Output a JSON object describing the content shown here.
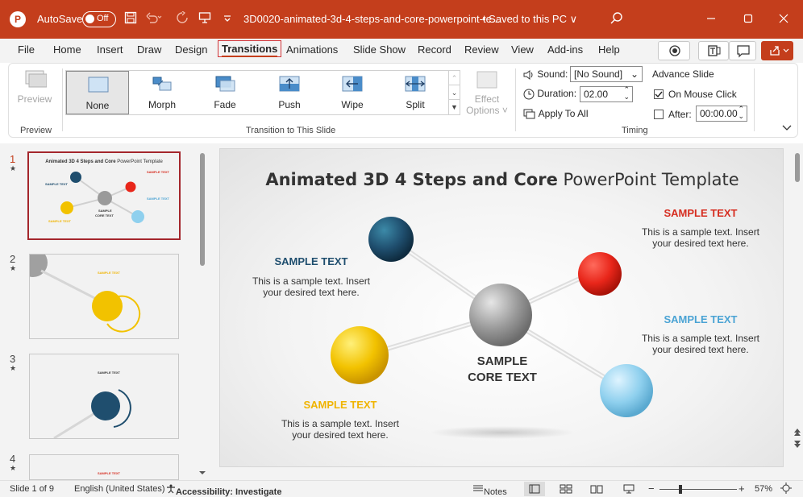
{
  "titlebar": {
    "logo": "P",
    "autosave_label": "AutoSave",
    "autosave_state": "Off",
    "doc_title": "3D0020-animated-3d-4-steps-and-core-powerpoint-te...",
    "saved_status": "• Saved to this PC ∨",
    "icons": [
      "save-icon",
      "undo-icon",
      "redo-icon",
      "present-icon",
      "customize-icon",
      "search-icon",
      "minimize-icon",
      "maximize-icon",
      "close-icon"
    ]
  },
  "menu": {
    "tabs": [
      "File",
      "Home",
      "Insert",
      "Draw",
      "Design",
      "Transitions",
      "Animations",
      "Slide Show",
      "Record",
      "Review",
      "View",
      "Add-ins",
      "Help"
    ],
    "active": "Transitions"
  },
  "ribbon": {
    "preview": {
      "label": "Preview",
      "group": "Preview"
    },
    "gallery": {
      "items": [
        "None",
        "Morph",
        "Fade",
        "Push",
        "Wipe",
        "Split"
      ],
      "selected": "None",
      "group": "Transition to This Slide"
    },
    "effect_options": {
      "line1": "Effect",
      "line2": "Options ˅"
    },
    "timing": {
      "sound_label": "Sound:",
      "sound_value": "[No Sound]",
      "duration_label": "Duration:",
      "duration_value": "02.00",
      "apply_all": "Apply To All",
      "advance_title": "Advance Slide",
      "on_mouse_click": "On Mouse Click",
      "on_mouse_click_checked": true,
      "after_label": "After:",
      "after_value": "00:00.00",
      "after_checked": false,
      "group": "Timing"
    }
  },
  "thumbnails": {
    "numbers": [
      "1",
      "2",
      "3",
      "4"
    ],
    "star": "★",
    "thumb1": {
      "title_bold": "Animated 3D 4 Steps and Core",
      "title_rest": " PowerPoint Template",
      "labels": [
        "SAMPLE TEXT",
        "SAMPLE TEXT",
        "SAMPLE TEXT",
        "SAMPLE TEXT",
        "SAMPLE",
        "CORE TEXT"
      ]
    },
    "thumb2": {
      "label": "SAMPLE TEXT"
    },
    "thumb3": {
      "label": "SAMPLE TEXT"
    },
    "thumb4": {
      "label": "SAMPLE TEXT"
    }
  },
  "slide": {
    "title_bold": "Animated 3D 4 Steps and Core",
    "title_rest": " PowerPoint Template",
    "blocks": [
      {
        "title": "SAMPLE TEXT",
        "color": "#1f4e6e",
        "line1": "This is a sample text. Insert",
        "line2": "your desired text here."
      },
      {
        "title": "SAMPLE TEXT",
        "color": "#d62d20",
        "line1": "This is a sample text. Insert",
        "line2": "your desired text here."
      },
      {
        "title": "SAMPLE TEXT",
        "color": "#4aa3d4",
        "line1": "This is a sample text. Insert",
        "line2": "your desired text here."
      },
      {
        "title": "SAMPLE TEXT",
        "color": "#f0b400",
        "line1": "This is a sample text. Insert",
        "line2": "your desired text here."
      }
    ],
    "core_line1": "SAMPLE",
    "core_line2": "CORE TEXT"
  },
  "statusbar": {
    "slide_info": "Slide 1 of 9",
    "language": "English (United States)",
    "accessibility": "Accessibility: Investigate",
    "notes": "Notes",
    "zoom_minus": "−",
    "zoom_plus": "+",
    "zoom": "57%",
    "zoom_level": 0.57
  },
  "colors": {
    "brand": "#c43e1c",
    "sphere_teal": "#1f4e6e",
    "sphere_red": "#e8261a",
    "sphere_yellow": "#f2c200",
    "sphere_lightblue": "#8fd0ee",
    "sphere_gray": "#9a9a9a"
  }
}
